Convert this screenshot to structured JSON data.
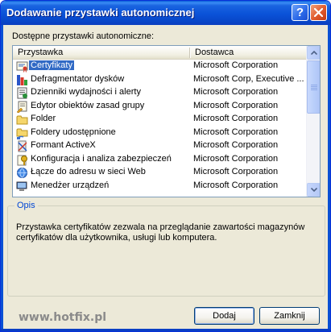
{
  "window": {
    "title": "Dodawanie przystawki autonomicznej",
    "help_glyph": "?",
    "titlebar_color": "#0a52d8"
  },
  "list": {
    "label": "Dostępne przystawki autonomiczne:",
    "columns": [
      "Przystawka",
      "Dostawca"
    ],
    "selected_index": 0,
    "selection_color": "#316ac5",
    "items": [
      {
        "name": "Certyfikaty",
        "vendor": "Microsoft Corporation",
        "icon": "certificate-icon"
      },
      {
        "name": "Defragmentator dysków",
        "vendor": "Microsoft Corp, Executive ...",
        "icon": "defrag-icon"
      },
      {
        "name": "Dzienniki wydajności i alerty",
        "vendor": "Microsoft Corporation",
        "icon": "performance-logs-icon"
      },
      {
        "name": "Edytor obiektów zasad grupy",
        "vendor": "Microsoft Corporation",
        "icon": "group-policy-icon"
      },
      {
        "name": "Folder",
        "vendor": "Microsoft Corporation",
        "icon": "folder-icon"
      },
      {
        "name": "Foldery udostępnione",
        "vendor": "Microsoft Corporation",
        "icon": "shared-folder-icon"
      },
      {
        "name": "Formant ActiveX",
        "vendor": "Microsoft Corporation",
        "icon": "activex-icon"
      },
      {
        "name": "Konfiguracja i analiza zabezpieczeń",
        "vendor": "Microsoft Corporation",
        "icon": "security-config-icon"
      },
      {
        "name": "Łącze do adresu w sieci Web",
        "vendor": "Microsoft Corporation",
        "icon": "web-link-icon"
      },
      {
        "name": "Menedżer urządzeń",
        "vendor": "Microsoft Corporation",
        "icon": "device-manager-icon"
      }
    ]
  },
  "description": {
    "legend": "Opis",
    "text": "Przystawka certyfikatów zezwala na przeglądanie zawartości magazynów certyfikatów dla użytkownika, usługi lub komputera."
  },
  "watermark": "www.hotfix.pl",
  "buttons": {
    "add": "Dodaj",
    "close": "Zamknij"
  }
}
